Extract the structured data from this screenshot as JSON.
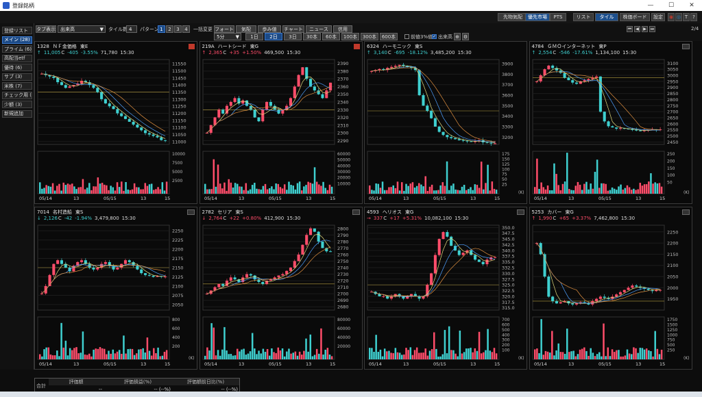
{
  "window": {
    "title": "登録銘柄"
  },
  "topbar": {
    "buttons": [
      {
        "label": "先物気配",
        "active": false
      },
      {
        "label": "優先市場",
        "active": true
      },
      {
        "label": "PTS",
        "active": false
      },
      {
        "label": "リスト",
        "active": false
      },
      {
        "label": "タイル",
        "active": true
      },
      {
        "label": "株価ボード",
        "active": false
      },
      {
        "label": "設定",
        "active": false
      }
    ]
  },
  "toolbar": {
    "tab_display_label": "タブ表示",
    "tab_display_value": "出来高",
    "tile_count_label": "タイル数",
    "tile_count_value": "4",
    "pattern_label": "パターン",
    "patterns": [
      "1",
      "2",
      "3",
      "4"
    ],
    "batch_change_label": "一括変更",
    "row1_buttons": [
      "フォート",
      "気配",
      "歩み値",
      "チャート",
      "ニュース",
      "信用"
    ],
    "interval_value": "5分",
    "periods": [
      "1日",
      "2日",
      "3日",
      "30本",
      "60本",
      "100本",
      "300本",
      "600本"
    ],
    "period_selected": "2日",
    "check_prev3": "前値3%値",
    "check_volume": "出来高",
    "page_indicator": "2/4"
  },
  "sidebar": {
    "items": [
      {
        "label": "登録リスト",
        "active": false
      },
      {
        "label": "メイン (28)",
        "active": true
      },
      {
        "label": "プライム (6)",
        "active": false
      },
      {
        "label": "高配当etf",
        "active": false
      },
      {
        "label": "優待 (6)",
        "active": false
      },
      {
        "label": "サブ (3)",
        "active": false
      },
      {
        "label": "米株 (7)",
        "active": false
      },
      {
        "label": "チェック用 (",
        "active": false
      },
      {
        "label": "少額 (3)",
        "active": false
      },
      {
        "label": "新規追加",
        "active": false
      }
    ]
  },
  "panels": [
    {
      "code": "1328",
      "name": "ＮＦ金価格",
      "market": "東E",
      "arrow": "↑",
      "price": "11,005",
      "pc": "C",
      "change": "-405",
      "pct": "-3.55%",
      "volume": "71,780",
      "time": "15:30",
      "dir": "dn",
      "badge": "red",
      "price_ticks": [
        "11550",
        "11500",
        "11450",
        "11400",
        "11350",
        "11300",
        "11250",
        "11200",
        "11150",
        "11100",
        "11050",
        "11000"
      ],
      "vol_ticks": [
        "10000",
        "7500",
        "5000",
        "2500"
      ],
      "dates": [
        "05/14",
        "13",
        "05/15",
        "13",
        "15"
      ],
      "vol_unit": "",
      "chart_data": {
        "type": "line",
        "ylim": [
          10980,
          11580
        ],
        "close": [
          11480,
          11470,
          11460,
          11450,
          11420,
          11400,
          11380,
          11390,
          11400,
          11410,
          11430,
          11420,
          11400,
          11380,
          11350,
          11300,
          11270,
          11250,
          11230,
          11200,
          11180,
          11160,
          11140,
          11120,
          11100,
          11080,
          11060,
          11050,
          11040,
          11030,
          11010,
          11005
        ]
      }
    },
    {
      "code": "219A",
      "name": "ハートシード",
      "market": "東G",
      "arrow": "↑",
      "price": "2,365",
      "pc": "C",
      "change": "+35",
      "pct": "+1.50%",
      "volume": "469,500",
      "time": "15:30",
      "dir": "up",
      "badge": "red",
      "price_ticks": [
        "2390",
        "2380",
        "2370",
        "2360",
        "2350",
        "2340",
        "2330",
        "2320",
        "2310",
        "2300",
        "2290"
      ],
      "vol_ticks": [
        "60000",
        "50000",
        "40000",
        "30000",
        "20000",
        "10000"
      ],
      "dates": [
        "05/14",
        "13",
        "05/15",
        "13",
        "15"
      ],
      "vol_unit": "",
      "chart_data": {
        "type": "line",
        "ylim": [
          2285,
          2395
        ],
        "close": [
          2300,
          2310,
          2320,
          2330,
          2325,
          2335,
          2340,
          2345,
          2338,
          2342,
          2335,
          2330,
          2320,
          2315,
          2330,
          2340,
          2335,
          2330,
          2325,
          2330,
          2335,
          2345,
          2360,
          2375,
          2385,
          2370,
          2360,
          2355,
          2350,
          2345,
          2355,
          2365
        ]
      }
    },
    {
      "code": "6324",
      "name": "ハーモニック",
      "market": "東S",
      "arrow": "↑",
      "price": "3,140",
      "pc": "C",
      "change": "-695",
      "pct": "-18.12%",
      "volume": "3,485,200",
      "time": "15:30",
      "dir": "dn",
      "badge": "none",
      "price_ticks": [
        "3900",
        "3800",
        "3700",
        "3600",
        "3500",
        "3400",
        "3300",
        "3200"
      ],
      "vol_ticks": [
        "175",
        "150",
        "125",
        "100",
        "75",
        "50",
        "25"
      ],
      "dates": [
        "05/14",
        "13",
        "05/15",
        "13",
        "15"
      ],
      "vol_unit": "(K)",
      "chart_data": {
        "type": "line",
        "ylim": [
          3130,
          3940
        ],
        "close": [
          3830,
          3840,
          3850,
          3840,
          3860,
          3870,
          3880,
          3890,
          3880,
          3870,
          3860,
          3840,
          3600,
          3500,
          3450,
          3380,
          3300,
          3250,
          3220,
          3200,
          3190,
          3180,
          3170,
          3165,
          3160,
          3155,
          3160,
          3170,
          3150,
          3145,
          3140,
          3140
        ]
      }
    },
    {
      "code": "4784",
      "name": "ＧＭＯインターネット",
      "market": "東P",
      "arrow": "↑",
      "price": "2,554",
      "pc": "C",
      "change": "-546",
      "pct": "-17.61%",
      "volume": "1,134,100",
      "time": "15:30",
      "dir": "dn",
      "badge": "gray",
      "price_ticks": [
        "3100",
        "3050",
        "3000",
        "2950",
        "2900",
        "2850",
        "2800",
        "2750",
        "2700",
        "2650",
        "2600",
        "2550",
        "2500",
        "2450"
      ],
      "vol_ticks": [
        "250",
        "200",
        "150",
        "100",
        "50"
      ],
      "dates": [
        "05/14",
        "13",
        "05/15",
        "13",
        "15"
      ],
      "vol_unit": "(K)",
      "chart_data": {
        "type": "line",
        "ylim": [
          2430,
          3130
        ],
        "close": [
          2950,
          3000,
          3050,
          3080,
          3060,
          3040,
          3020,
          2980,
          2960,
          2940,
          2930,
          2950,
          2960,
          2970,
          2980,
          2990,
          2700,
          2620,
          2580,
          2570,
          2560,
          2565,
          2560,
          2555,
          2550,
          2545,
          2540,
          2545,
          2550,
          2555,
          2550,
          2554
        ]
      }
    },
    {
      "code": "7014",
      "name": "名村造船",
      "market": "東S",
      "arrow": "↓",
      "price": "2,126",
      "pc": "C",
      "change": "-42",
      "pct": "-1.94%",
      "volume": "3,479,800",
      "time": "15:30",
      "dir": "dn",
      "badge": "gray",
      "price_ticks": [
        "2250",
        "2225",
        "2200",
        "2175",
        "2150",
        "2125",
        "2100",
        "2075",
        "2050"
      ],
      "vol_ticks": [
        "800",
        "600",
        "400",
        "200"
      ],
      "dates": [
        "05/14",
        "13",
        "05/15",
        "13",
        "15"
      ],
      "vol_unit": "(K)",
      "chart_data": {
        "type": "line",
        "ylim": [
          2035,
          2265
        ],
        "close": [
          2080,
          2100,
          2130,
          2160,
          2170,
          2160,
          2150,
          2140,
          2155,
          2165,
          2170,
          2160,
          2150,
          2145,
          2150,
          2160,
          2165,
          2155,
          2145,
          2150,
          2160,
          2170,
          2165,
          2155,
          2145,
          2135,
          2130,
          2128,
          2125,
          2127,
          2126,
          2126
        ]
      }
    },
    {
      "code": "2782",
      "name": "セリア",
      "market": "東S",
      "arrow": "↓",
      "price": "2,764",
      "pc": "C",
      "change": "+22",
      "pct": "+0.80%",
      "volume": "412,900",
      "time": "15:30",
      "dir": "up",
      "badge": "gray",
      "price_ticks": [
        "2800",
        "2790",
        "2780",
        "2770",
        "2760",
        "2750",
        "2740",
        "2730",
        "2720",
        "2710",
        "2700",
        "2690",
        "2680"
      ],
      "vol_ticks": [
        "80000",
        "60000",
        "40000",
        "20000"
      ],
      "dates": [
        "05/14",
        "13",
        "05/15",
        "13",
        "15"
      ],
      "vol_unit": "",
      "chart_data": {
        "type": "line",
        "ylim": [
          2675,
          2805
        ],
        "close": [
          2700,
          2705,
          2710,
          2715,
          2712,
          2720,
          2725,
          2722,
          2718,
          2725,
          2730,
          2728,
          2722,
          2718,
          2715,
          2720,
          2722,
          2725,
          2728,
          2730,
          2735,
          2740,
          2750,
          2760,
          2775,
          2790,
          2800,
          2795,
          2780,
          2770,
          2765,
          2764
        ]
      }
    },
    {
      "code": "4593",
      "name": "ヘリオス",
      "market": "東G",
      "arrow": "→",
      "price": "337",
      "pc": "C",
      "change": "+17",
      "pct": "+5.31%",
      "volume": "10,082,100",
      "time": "15:30",
      "dir": "up",
      "badge": "gray",
      "price_ticks": [
        "350.0",
        "347.5",
        "345.0",
        "342.5",
        "340.0",
        "337.5",
        "335.0",
        "332.5",
        "330.0",
        "327.5",
        "325.0",
        "322.5",
        "320.0",
        "317.5",
        "315.0"
      ],
      "vol_ticks": [
        "700",
        "600",
        "500",
        "400",
        "300",
        "200",
        "100"
      ],
      "dates": [
        "05/14",
        "13",
        "05/15",
        "13",
        "15"
      ],
      "vol_unit": "(K)",
      "chart_data": {
        "type": "line",
        "ylim": [
          314,
          351
        ],
        "close": [
          322,
          321,
          320,
          320,
          319,
          320,
          321,
          320,
          319,
          320,
          321,
          320,
          319,
          320,
          325,
          330,
          338,
          345,
          348,
          346,
          342,
          340,
          338,
          339,
          340,
          338,
          336,
          335,
          334,
          336,
          337,
          337
        ]
      }
    },
    {
      "code": "5253",
      "name": "カバー",
      "market": "東G",
      "arrow": "↑",
      "price": "1,990",
      "pc": "C",
      "change": "+65",
      "pct": "+3.37%",
      "volume": "7,462,800",
      "time": "15:30",
      "dir": "up",
      "badge": "gray",
      "price_ticks": [
        "2250",
        "2200",
        "2150",
        "2100",
        "2050",
        "2000",
        "1950"
      ],
      "vol_ticks": [
        "1750",
        "1500",
        "1250",
        "1000",
        "750",
        "500",
        "250"
      ],
      "dates": [
        "05/14",
        "13",
        "05/15",
        "13",
        "15"
      ],
      "vol_unit": "(K)",
      "chart_data": {
        "type": "line",
        "ylim": [
          1900,
          2280
        ],
        "close": [
          2200,
          2150,
          2050,
          1960,
          1940,
          1930,
          1935,
          1940,
          1930,
          1925,
          1930,
          1935,
          1930,
          1925,
          1940,
          1950,
          1960,
          1955,
          1950,
          1960,
          1970,
          1980,
          1990,
          2000,
          2010,
          2005,
          2000,
          1995,
          1990,
          1985,
          1990,
          1990
        ]
      }
    }
  ],
  "summary": {
    "headers": [
      "評価額",
      "評価損益(%)",
      "評価額前日比(%)"
    ],
    "row_label": "合計",
    "values": [
      "--",
      "-- (--%)",
      "-- (--%)"
    ]
  }
}
